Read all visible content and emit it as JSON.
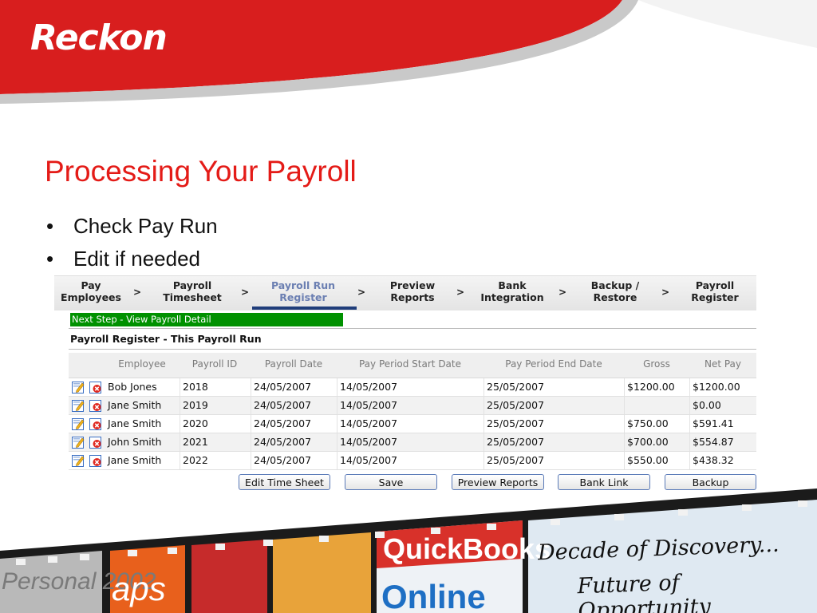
{
  "logo": {
    "text": "Reckon"
  },
  "slide": {
    "title": "Processing Your Payroll",
    "bullets": [
      "Check Pay Run",
      "Edit if needed"
    ]
  },
  "wizard": {
    "steps": [
      {
        "line1": "Pay",
        "line2": "Employees",
        "active": false
      },
      {
        "line1": "Payroll",
        "line2": "Timesheet",
        "active": false
      },
      {
        "line1": "Payroll Run",
        "line2": "Register",
        "active": true
      },
      {
        "line1": "Preview",
        "line2": "Reports",
        "active": false
      },
      {
        "line1": "Bank",
        "line2": "Integration",
        "active": false
      },
      {
        "line1": "Backup /",
        "line2": "Restore",
        "active": false
      },
      {
        "line1": "Payroll",
        "line2": "Register",
        "active": false
      }
    ],
    "separator": ">"
  },
  "next_step": "Next Step - View Payroll Detail",
  "register_title": "Payroll Register - This Payroll Run",
  "table": {
    "headers": [
      "Employee",
      "Payroll ID",
      "Payroll Date",
      "Pay Period Start Date",
      "Pay Period End Date",
      "Gross",
      "Net Pay"
    ],
    "rows": [
      {
        "employee": "Bob Jones",
        "payroll_id": "2018",
        "payroll_date": "24/05/2007",
        "start": "14/05/2007",
        "end": "25/05/2007",
        "gross": "$1200.00",
        "net": "$1200.00"
      },
      {
        "employee": "Jane Smith",
        "payroll_id": "2019",
        "payroll_date": "24/05/2007",
        "start": "14/05/2007",
        "end": "25/05/2007",
        "gross": "",
        "net": "$0.00"
      },
      {
        "employee": "Jane Smith",
        "payroll_id": "2020",
        "payroll_date": "24/05/2007",
        "start": "14/05/2007",
        "end": "25/05/2007",
        "gross": "$750.00",
        "net": "$591.41"
      },
      {
        "employee": "John Smith",
        "payroll_id": "2021",
        "payroll_date": "24/05/2007",
        "start": "14/05/2007",
        "end": "25/05/2007",
        "gross": "$700.00",
        "net": "$554.87"
      },
      {
        "employee": "Jane Smith",
        "payroll_id": "2022",
        "payroll_date": "24/05/2007",
        "start": "14/05/2007",
        "end": "25/05/2007",
        "gross": "$550.00",
        "net": "$438.32"
      }
    ],
    "row_icons": [
      "edit-icon",
      "delete-icon"
    ]
  },
  "buttons": {
    "edit_time_sheet": "Edit Time Sheet",
    "save": "Save",
    "preview_reports": "Preview Reports",
    "bank_link": "Bank Link",
    "backup": "Backup"
  },
  "footer": {
    "tagline_line1": "Decade of Discovery...",
    "tagline_line2": "Future of Opportunity",
    "film_labels": [
      "Personal 2002",
      "aps",
      "QuickBooks",
      "Online"
    ]
  },
  "colors": {
    "brand_red": "#e41b17",
    "next_step_green": "#009100",
    "active_step": "#6b7fb2",
    "active_underline": "#1f3d7a"
  }
}
